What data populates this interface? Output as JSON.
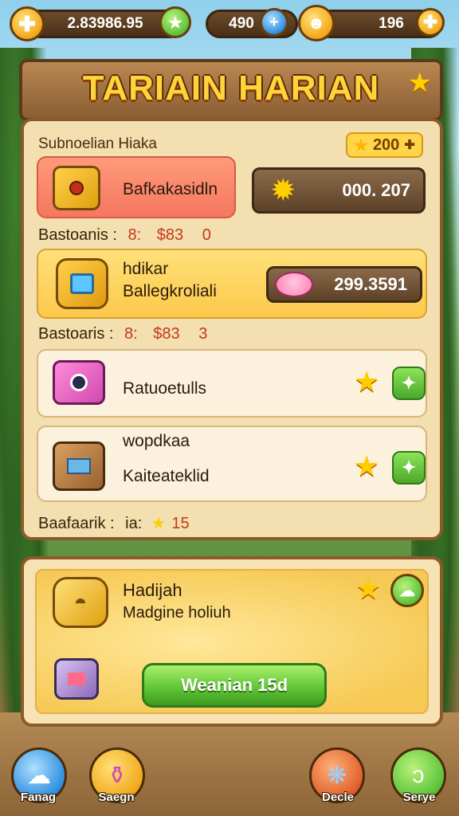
{
  "topbar": {
    "coins_value": "2.83986.95",
    "gems_value": "490",
    "energy_value": "196"
  },
  "header": {
    "title": "TARIAIN HARIAN"
  },
  "board": {
    "section_title": "Subnoelian Hiaka",
    "bonus_badge": "200",
    "card1": {
      "label": "Bafkakasidln",
      "value": "000. 207"
    },
    "status1": {
      "prefix": "Bastoanis :",
      "a": "8:",
      "b": "$83",
      "c": "0"
    },
    "card2": {
      "title": "hdikar",
      "subtitle": "Ballegkroliali",
      "value": "299.3591"
    },
    "status2": {
      "prefix": "Bastoaris :",
      "a": "8:",
      "b": "$83",
      "c": "3"
    },
    "card3": {
      "label": "Ratuoetulls"
    },
    "card4": {
      "title": "wopdkaa",
      "subtitle": "Kaiteateklid"
    },
    "status3": {
      "prefix": "Baafaarik :",
      "a": "ia:",
      "b": "15"
    }
  },
  "reward": {
    "title": "Hadijah",
    "subtitle": "Madgine holiuh",
    "claim_label": "Weanian 15d"
  },
  "nav": [
    {
      "label": "Fanag"
    },
    {
      "label": "Saegn"
    },
    {
      "label": "Decle"
    },
    {
      "label": "Serye"
    }
  ],
  "colors": {
    "wood_dark": "#5a3a1c",
    "board_bg": "#f3dfb0",
    "title_gold": "#ffd43b",
    "accent_green": "#5cc23a",
    "accent_red": "#c23a1a"
  }
}
